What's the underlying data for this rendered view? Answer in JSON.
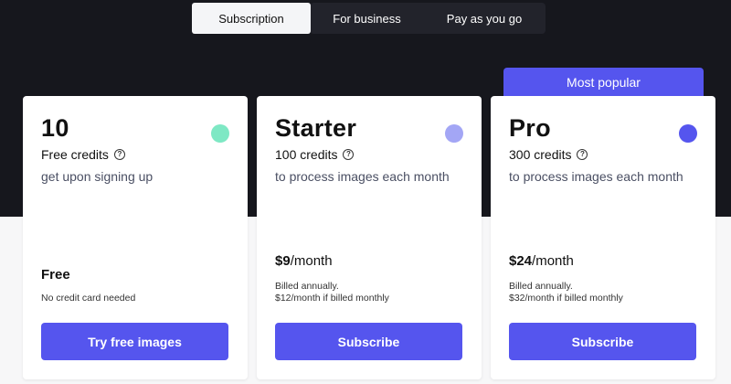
{
  "tabs": [
    {
      "label": "Subscription",
      "active": true
    },
    {
      "label": "For business",
      "active": false
    },
    {
      "label": "Pay as you go",
      "active": false
    }
  ],
  "popular_badge": "Most popular",
  "colors": {
    "accent": "#5555ee",
    "dark_bg": "#16171d",
    "dot_free": "#7ee8c4",
    "dot_starter": "#a3a6f5",
    "dot_pro": "#5555ee"
  },
  "plans": [
    {
      "name": "10",
      "credits": "Free credits",
      "description": "get upon signing up",
      "price_label": "Free",
      "note": "No credit card needed",
      "cta": "Try free images",
      "help_icon": "question-circle-icon"
    },
    {
      "name": "Starter",
      "credits": "100 credits",
      "description": "to process images each month",
      "price_amount": "$9",
      "price_unit": "/month",
      "note_line1": "Billed annually.",
      "note_line2": "$12/month if billed monthly",
      "cta": "Subscribe",
      "help_icon": "question-circle-icon"
    },
    {
      "name": "Pro",
      "credits": "300 credits",
      "description": "to process images each month",
      "price_amount": "$24",
      "price_unit": "/month",
      "note_line1": "Billed annually.",
      "note_line2": "$32/month if billed monthly",
      "cta": "Subscribe",
      "help_icon": "question-circle-icon"
    }
  ]
}
